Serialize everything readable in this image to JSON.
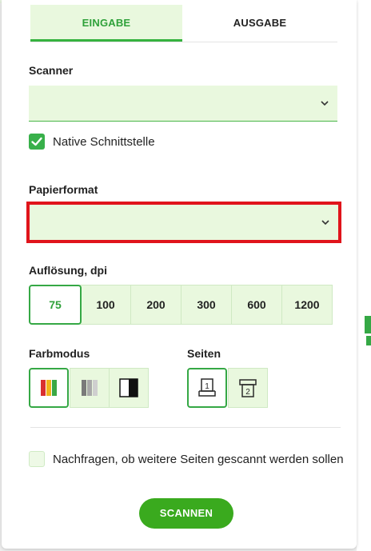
{
  "tabs": [
    {
      "label": "EINGABE",
      "active": true
    },
    {
      "label": "AUSGABE",
      "active": false
    }
  ],
  "scanner": {
    "label": "Scanner",
    "value": ""
  },
  "native_interface": {
    "label": "Native Schnittstelle",
    "checked": true
  },
  "paper_format": {
    "label": "Papierformat",
    "value": ""
  },
  "resolution": {
    "label": "Auflösung, dpi",
    "options": [
      "75",
      "100",
      "200",
      "300",
      "600",
      "1200"
    ],
    "selected": "75"
  },
  "color_mode": {
    "label": "Farbmodus",
    "options": [
      "color-mode-icon",
      "grayscale-mode-icon",
      "black-white-mode-icon"
    ],
    "selected": "color-mode-icon"
  },
  "pages": {
    "label": "Seiten",
    "options": [
      "single-sided-icon",
      "double-sided-icon"
    ],
    "selected": "single-sided-icon"
  },
  "ask_more_pages": {
    "label": "Nachfragen, ob weitere Seiten gescannt werden sollen",
    "checked": false
  },
  "scan_button": {
    "label": "SCANNEN"
  },
  "colors": {
    "accent": "#35a845",
    "field_bg": "#e9f8de",
    "highlight": "#e0141b",
    "scan_button": "#3aaa1e"
  }
}
